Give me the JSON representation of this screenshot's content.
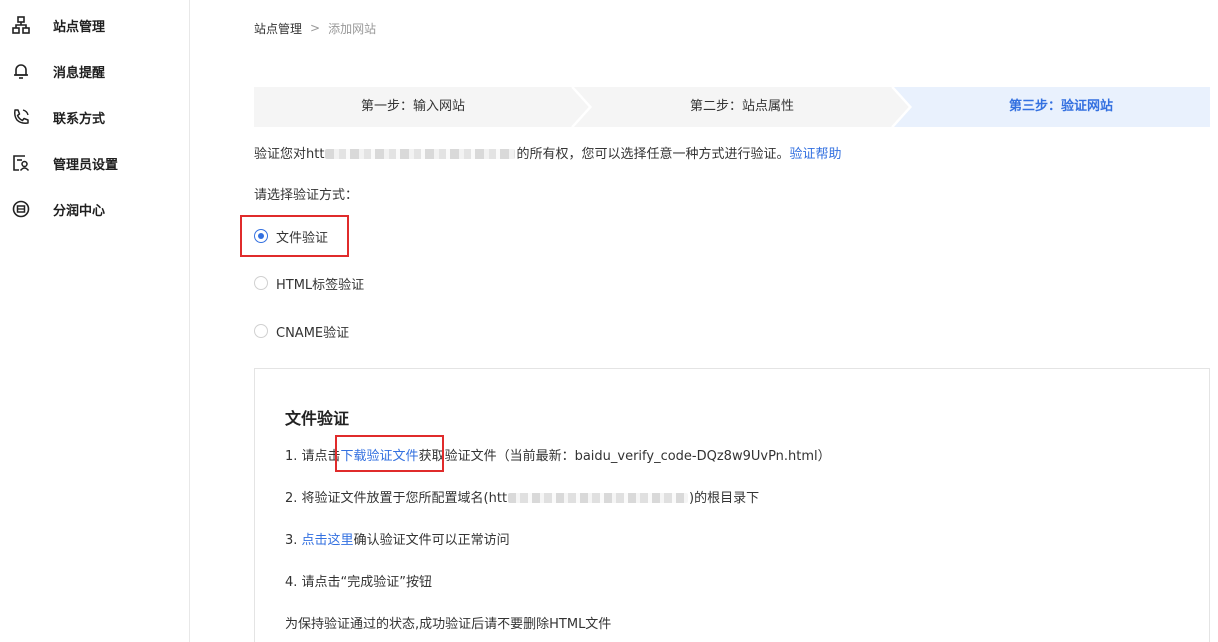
{
  "sidebar": {
    "items": [
      {
        "label": "站点管理",
        "icon": "sitemap-icon"
      },
      {
        "label": "消息提醒",
        "icon": "bell-icon"
      },
      {
        "label": "联系方式",
        "icon": "phone-icon"
      },
      {
        "label": "管理员设置",
        "icon": "admin-icon"
      },
      {
        "label": "分润中心",
        "icon": "profit-icon"
      }
    ]
  },
  "breadcrumb": {
    "root": "站点管理",
    "separator": ">",
    "current": "添加网站"
  },
  "steps": [
    {
      "label": "第一步：输入网站",
      "active": false
    },
    {
      "label": "第二步：站点属性",
      "active": false
    },
    {
      "label": "第三步：验证网站",
      "active": true
    }
  ],
  "intro": {
    "prefix": "验证您对htt",
    "suffix": "的所有权，您可以选择任意一种方式进行验证。",
    "help_link": "验证帮助"
  },
  "method": {
    "title": "请选择验证方式：",
    "options": [
      {
        "label": "文件验证",
        "checked": true
      },
      {
        "label": "HTML标签验证",
        "checked": false
      },
      {
        "label": "CNAME验证",
        "checked": false
      }
    ]
  },
  "panel": {
    "title": "文件验证",
    "step1_prefix": "1. 请点击",
    "step1_link": "下载验证文件",
    "step1_suffix": "获取验证文件（当前最新：baidu_verify_code-DQz8w9UvPn.html）",
    "step2_prefix": "2. 将验证文件放置于您所配置域名(htt",
    "step2_suffix": ")的根目录下",
    "step3_prefix": "3. ",
    "step3_link": "点击这里",
    "step3_suffix": "确认验证文件可以正常访问",
    "step4": "4. 请点击“完成验证”按钮",
    "note": "为保持验证通过的状态,成功验证后请不要删除HTML文件"
  },
  "colors": {
    "accent": "#3370e0",
    "active_step_bg": "#e9f1fd",
    "inactive_step_bg": "#f5f5f5",
    "highlight": "#e02b2b"
  }
}
